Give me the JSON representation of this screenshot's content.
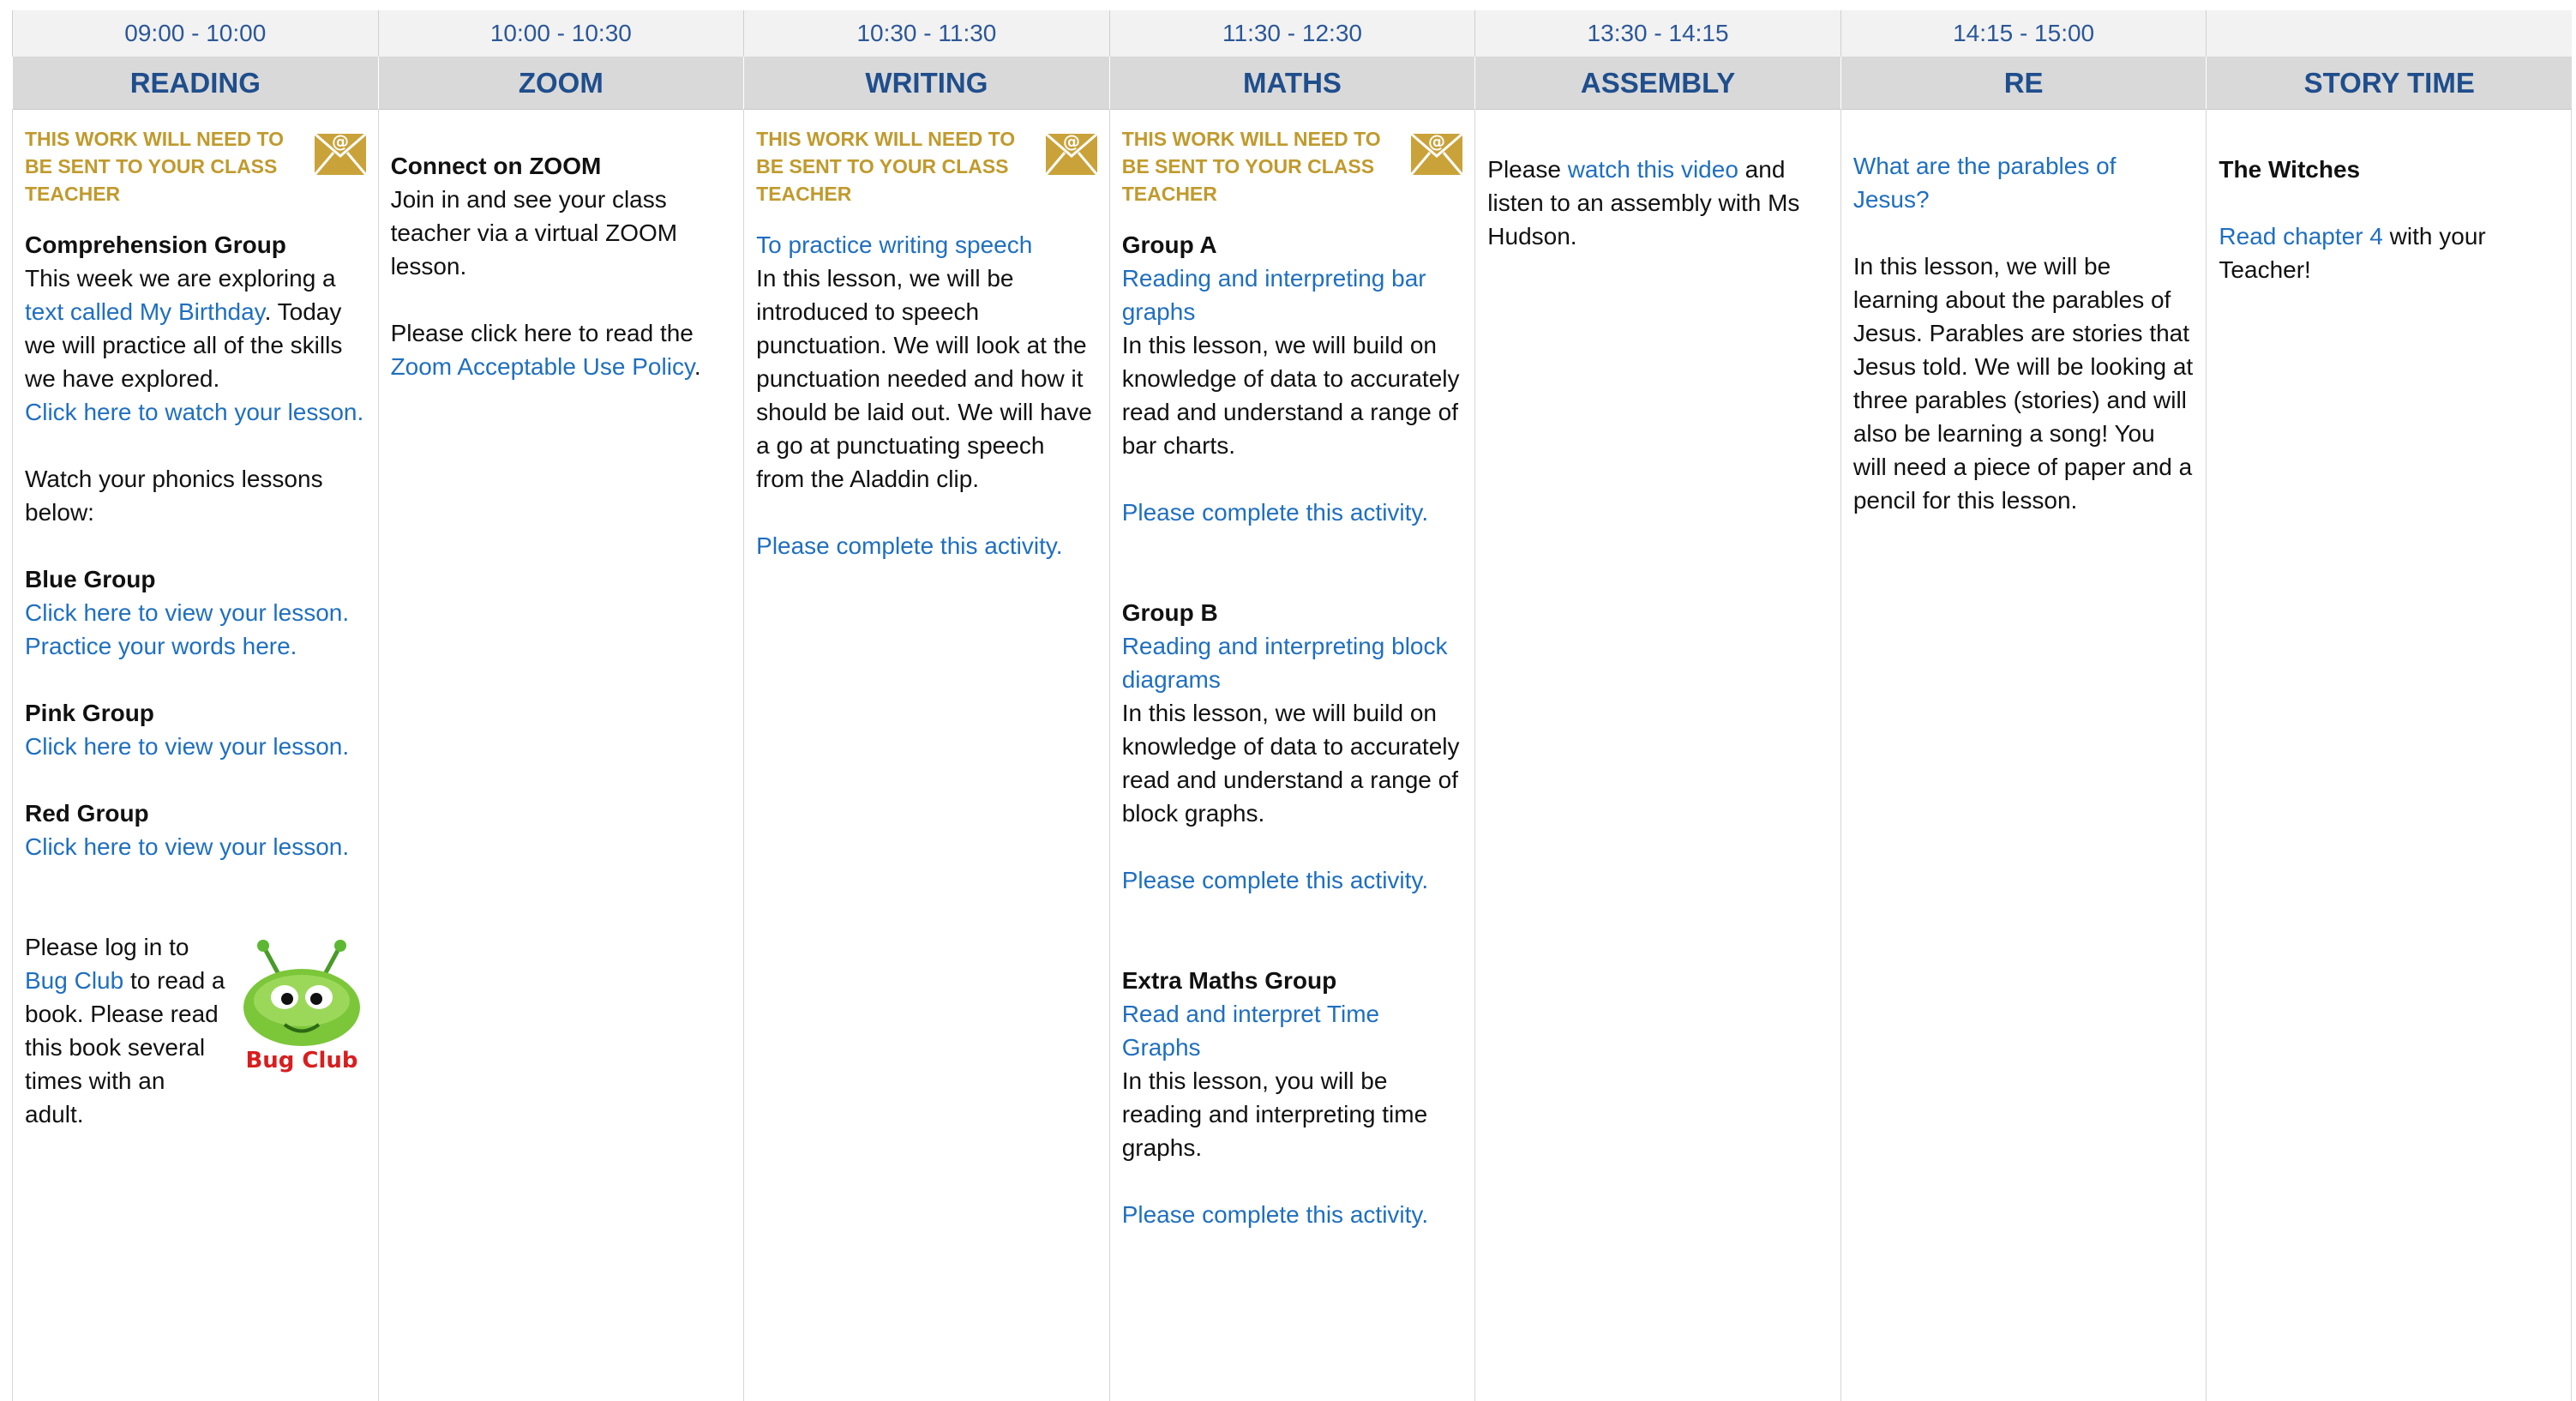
{
  "times": [
    "09:00 - 10:00",
    "10:00 - 10:30",
    "10:30 - 11:30",
    "11:30 - 12:30",
    "13:30 - 14:15",
    "14:15 - 15:00",
    ""
  ],
  "subjects": [
    "READING",
    "ZOOM",
    "WRITING",
    "MATHS",
    "ASSEMBLY",
    "RE",
    "STORY TIME"
  ],
  "notice": "THIS WORK WILL NEED TO BE SENT TO YOUR CLASS TEACHER",
  "icons": {
    "mail": "email-envelope-icon",
    "bug": "bug-club-logo"
  },
  "colors": {
    "link": "#1f6fbf",
    "header_text": "#1f4e8c",
    "notice": "#c09a2d"
  },
  "reading": {
    "comp_title": "Comprehension Group",
    "comp_t1": "This week we are exploring a ",
    "comp_link1": "text called My Birthday",
    "comp_t2": ". Today we will practice all of the skills we have explored.",
    "comp_link2": "Click here to watch your lesson.",
    "phonics": "Watch your phonics lessons below:",
    "blue_title": "Blue Group",
    "blue_link1": "Click here to view your lesson.",
    "blue_link2": "Practice your words here.",
    "pink_title": "Pink Group",
    "pink_link": "Click here to view your lesson.",
    "red_title": "Red Group",
    "red_link": "Click here to view your lesson.",
    "bug_t1": "Please log in to ",
    "bug_link": "Bug Club",
    "bug_t2": " to read a book. Please read this book several times with an adult.",
    "bug_logo_text": "Bug Club"
  },
  "zoom": {
    "title": "Connect on ZOOM",
    "t1": "Join in and see your class teacher via a virtual ZOOM lesson.",
    "t2": "Please click here to read the ",
    "link": "Zoom Acceptable Use Policy",
    "t3": "."
  },
  "writing": {
    "link1": "To practice writing speech",
    "text": "In this lesson, we will be introduced to speech punctuation. We will look at the punctuation needed and how it should be laid out. We will have a go at punctuating speech from the Aladdin clip.",
    "link2": "Please complete this activity."
  },
  "maths": {
    "a_title": "Group A",
    "a_link": "Reading and interpreting bar graphs",
    "a_text": "In this lesson, we will build on knowledge of data to accurately read and understand a range of bar charts.",
    "a_act": "Please complete this activity.",
    "b_title": "Group B",
    "b_link": "Reading and interpreting block diagrams",
    "b_text": "In this lesson, we will build on knowledge of data to accurately read and understand a range of block graphs.",
    "b_act": "Please complete this activity.",
    "x_title": "Extra Maths Group",
    "x_link": "Read and interpret Time Graphs",
    "x_text": "In this lesson, you will be reading and interpreting time graphs.",
    "x_act": "Please complete this activity."
  },
  "assembly": {
    "t1": "Please ",
    "link": "watch this video",
    "t2": " and listen to an assembly with Ms Hudson."
  },
  "re": {
    "link": "What are the parables of Jesus?",
    "text": "In this lesson, we will be learning about the parables of Jesus. Parables are stories that Jesus told. We will be looking at three parables (stories) and will also be learning a song! You will need a piece of paper and a pencil for this lesson."
  },
  "story": {
    "title": "The Witches",
    "link": "Read chapter 4",
    "t1": " with your Teacher!"
  }
}
